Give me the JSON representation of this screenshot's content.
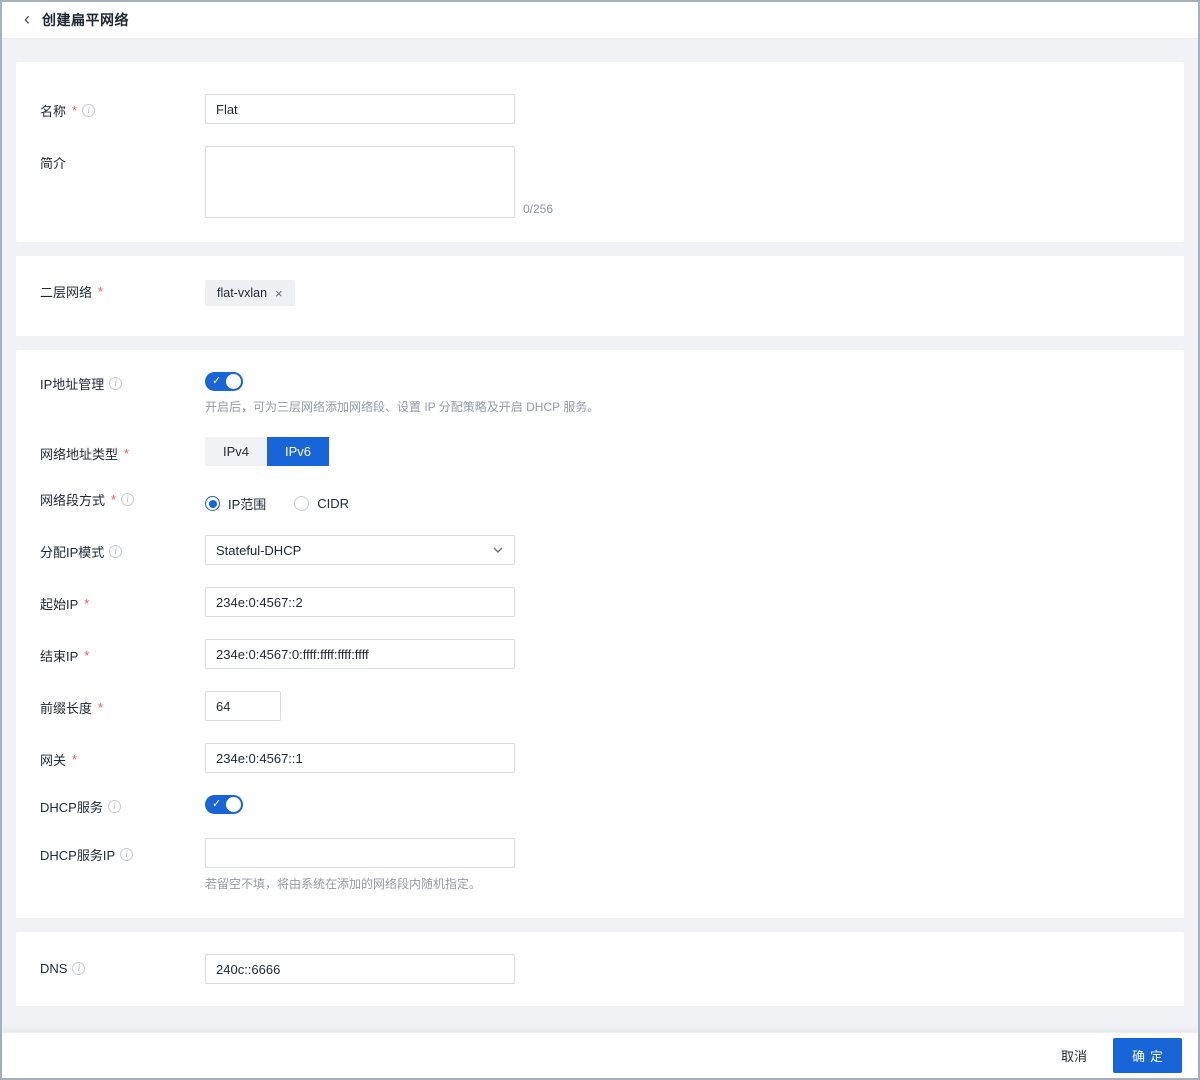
{
  "header": {
    "back_icon": "‹",
    "title": "创建扁平网络"
  },
  "ui": {
    "required_marker": "*",
    "info_glyph": "i",
    "remove_icon": "×",
    "check_glyph": "✓"
  },
  "fields": {
    "name": {
      "label": "名称",
      "value": "Flat"
    },
    "description": {
      "label": "简介",
      "value": "",
      "counter": "0/256"
    },
    "l2_network": {
      "label": "二层网络",
      "tag": "flat-vxlan"
    },
    "ip_mgmt": {
      "label": "IP地址管理",
      "state": "on",
      "hint": "开启后，可为三层网络添加网络段、设置 IP 分配策略及开启 DHCP 服务。"
    },
    "addr_type": {
      "label": "网络地址类型",
      "options": [
        "IPv4",
        "IPv6"
      ],
      "selected": "IPv6"
    },
    "segment_mode": {
      "label": "网络段方式",
      "options": [
        "IP范围",
        "CIDR"
      ],
      "selected": "IP范围"
    },
    "alloc_mode": {
      "label": "分配IP模式",
      "value": "Stateful-DHCP"
    },
    "start_ip": {
      "label": "起始IP",
      "value": "234e:0:4567::2"
    },
    "end_ip": {
      "label": "结束IP",
      "value": "234e:0:4567:0:ffff:ffff:ffff:ffff"
    },
    "prefix_len": {
      "label": "前缀长度",
      "value": "64"
    },
    "gateway": {
      "label": "网关",
      "value": "234e:0:4567::1"
    },
    "dhcp": {
      "label": "DHCP服务",
      "state": "on"
    },
    "dhcp_ip": {
      "label": "DHCP服务IP",
      "value": "",
      "hint": "若留空不填，将由系统在添加的网络段内随机指定。"
    },
    "dns": {
      "label": "DNS",
      "value": "240c::6666"
    }
  },
  "footer": {
    "cancel_label": "取消",
    "confirm_label": "确定"
  },
  "colors": {
    "primary": "#1765d9",
    "page_bg": "#f0f2f5",
    "required": "#f2555a"
  }
}
